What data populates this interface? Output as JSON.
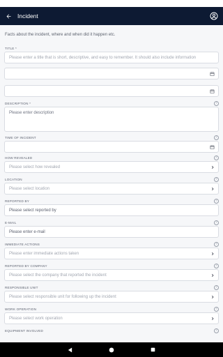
{
  "appbar": {
    "title": "Incident"
  },
  "intro": "Facts about the incident, where and when did it happen etc.",
  "fields": {
    "title": {
      "label": "TITLE *",
      "placeholder": "Please enter a title that is short, descriptive, and easy to remember. It should also include information"
    },
    "date": {
      "value": ""
    },
    "time": {
      "value": ""
    },
    "description": {
      "label": "DESCRIPTION *",
      "placeholder": "Please enter description"
    },
    "time_of_incident": {
      "label": "TIME OF INCIDENT",
      "value": ""
    },
    "how_revealed": {
      "label": "HOW REVEALED",
      "placeholder": "Please select how revealed"
    },
    "location": {
      "label": "LOCATION",
      "placeholder": "Please select location"
    },
    "reported_by": {
      "label": "REPORTED BY",
      "value": "Please select reported by"
    },
    "email": {
      "label": "E-MAIL",
      "value": "Please enter e-mail"
    },
    "immediate_actions": {
      "label": "IMMEDIATE ACTIONS",
      "placeholder": "Please enter immediate actions taken"
    },
    "reported_by_company": {
      "label": "REPORTED BY COMPANY",
      "placeholder": "Please select the company that reported the incident"
    },
    "responsible_unit": {
      "label": "RESPONSIBLE UNIT",
      "placeholder": "Please select responsible unit for following up the incident"
    },
    "work_operation": {
      "label": "WORK OPERATION",
      "placeholder": "Please select work operation"
    },
    "equipment_involved": {
      "label": "EQUIPMENT INVOLVED"
    }
  },
  "help_glyph": "?",
  "icons": {
    "back": "arrow-left-icon",
    "account": "account-circle-icon",
    "calendar": "calendar-icon",
    "chevron": "chevron-right-icon",
    "nav_back": "triangle-back-icon",
    "nav_home": "circle-home-icon",
    "nav_recents": "square-recents-icon"
  },
  "colors": {
    "appbar": "#0d1a33",
    "background": "#f6f7f9",
    "navbar": "#000000"
  }
}
